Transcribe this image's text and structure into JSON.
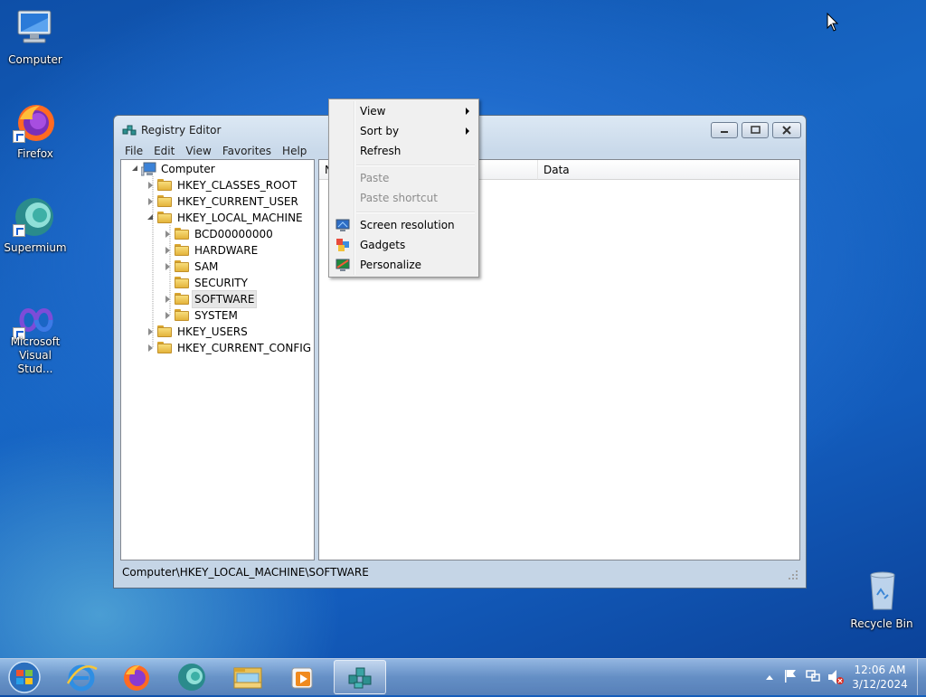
{
  "desktop": {
    "icons": [
      {
        "label": "Computer"
      },
      {
        "label": "Firefox"
      },
      {
        "label": "Supermium"
      },
      {
        "label": "Microsoft Visual Stud..."
      },
      {
        "label": "Recycle Bin"
      }
    ]
  },
  "window": {
    "title": "Registry Editor",
    "menu": [
      "File",
      "Edit",
      "View",
      "Favorites",
      "Help"
    ],
    "tree": {
      "root": "Computer",
      "hives": [
        "HKEY_CLASSES_ROOT",
        "HKEY_CURRENT_USER",
        "HKEY_LOCAL_MACHINE",
        "HKEY_USERS",
        "HKEY_CURRENT_CONFIG"
      ],
      "hklm_children": [
        "BCD00000000",
        "HARDWARE",
        "SAM",
        "SECURITY",
        "SOFTWARE",
        "SYSTEM"
      ]
    },
    "columns": {
      "name": "N",
      "data": "Data"
    },
    "status": "Computer\\HKEY_LOCAL_MACHINE\\SOFTWARE"
  },
  "context_menu": {
    "view": "View",
    "sort_by": "Sort by",
    "refresh": "Refresh",
    "paste": "Paste",
    "paste_shortcut": "Paste shortcut",
    "screen_resolution": "Screen resolution",
    "gadgets": "Gadgets",
    "personalize": "Personalize"
  },
  "taskbar": {
    "clock_time": "12:06 AM",
    "clock_date": "3/12/2024"
  }
}
